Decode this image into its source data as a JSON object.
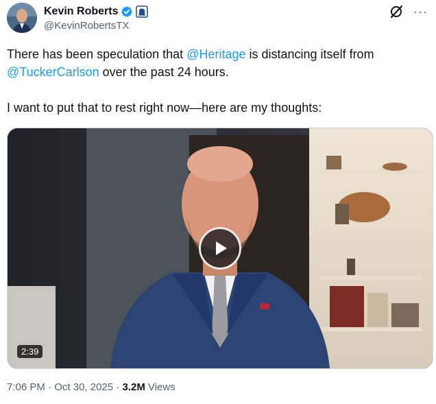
{
  "author": {
    "display_name": "Kevin Roberts",
    "handle": "@KevinRobertsTX",
    "verified_icon": "verified-check-icon",
    "affiliate_icon": "heritage-bell-icon"
  },
  "header_icons": {
    "grok_icon": "grok-slash-icon",
    "more_icon": "···"
  },
  "post": {
    "line1_prefix": "There has been speculation that ",
    "mention1": "@Heritage",
    "line1_suffix": " is distancing itself from",
    "mention2": "@TuckerCarlson",
    "line2_suffix": " over the past 24 hours.",
    "paragraph2": "I want to put that to rest right now—here are my thoughts:"
  },
  "media": {
    "duration": "2:39",
    "play_icon": "play-icon"
  },
  "meta": {
    "time": "7:06 PM",
    "separator1": " · ",
    "date": "Oct 30, 2025",
    "separator2": " · ",
    "views_count": "3.2M",
    "views_label": " Views"
  },
  "colors": {
    "accent": "#1d9bf0",
    "text": "#0f1419",
    "secondary": "#536471"
  }
}
